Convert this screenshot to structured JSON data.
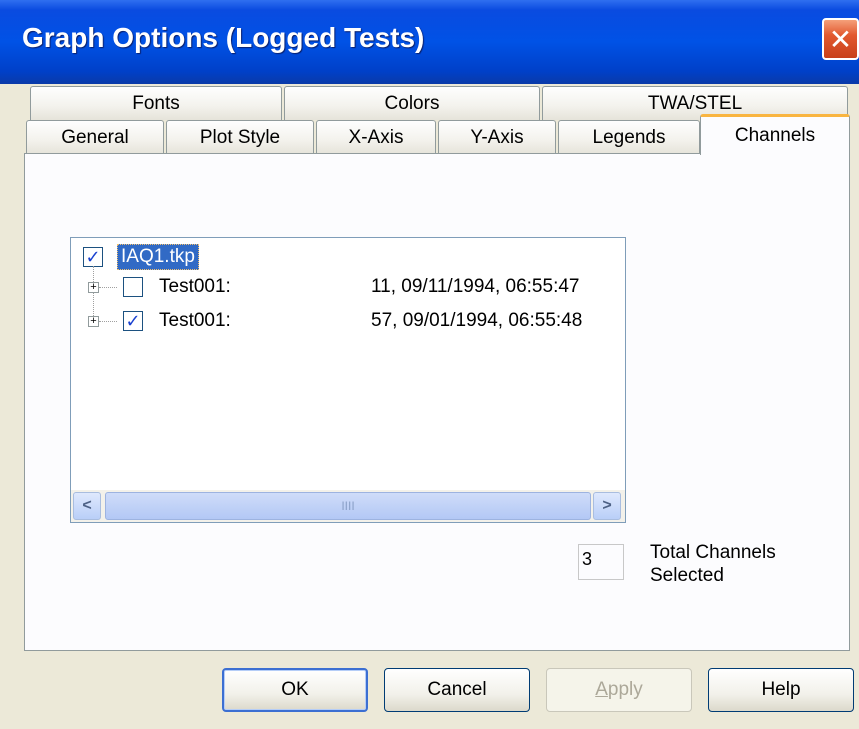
{
  "window": {
    "title": "Graph Options (Logged Tests)",
    "close_glyph": "✕"
  },
  "tabs": {
    "back_row": [
      "Fonts",
      "Colors",
      "TWA/STEL"
    ],
    "front_row": [
      "General",
      "Plot Style",
      "X-Axis",
      "Y-Axis",
      "Legends",
      "Channels"
    ],
    "active": "Channels"
  },
  "tree": {
    "root": {
      "label": "IAQ1.tkp",
      "checked": true,
      "selected": true
    },
    "items": [
      {
        "name": "Test001:",
        "info": "11, 09/11/1994, 06:55:47",
        "checked": false
      },
      {
        "name": "Test001:",
        "info": "57, 09/01/1994, 06:55:48",
        "checked": true
      }
    ],
    "scroll_left_glyph": "<",
    "scroll_right_glyph": ">",
    "scroll_thumb_grip": "IIII"
  },
  "channels": {
    "count": "3",
    "label_line1": "Total Channels",
    "label_line2": "Selected"
  },
  "buttons": {
    "ok": "OK",
    "cancel": "Cancel",
    "apply_mnemonic": "A",
    "apply_rest": "pply",
    "help": "Help"
  },
  "colors": {
    "titlebar": "#0052e6",
    "active_tab_accent": "#f9b541",
    "selection": "#316ac5"
  }
}
